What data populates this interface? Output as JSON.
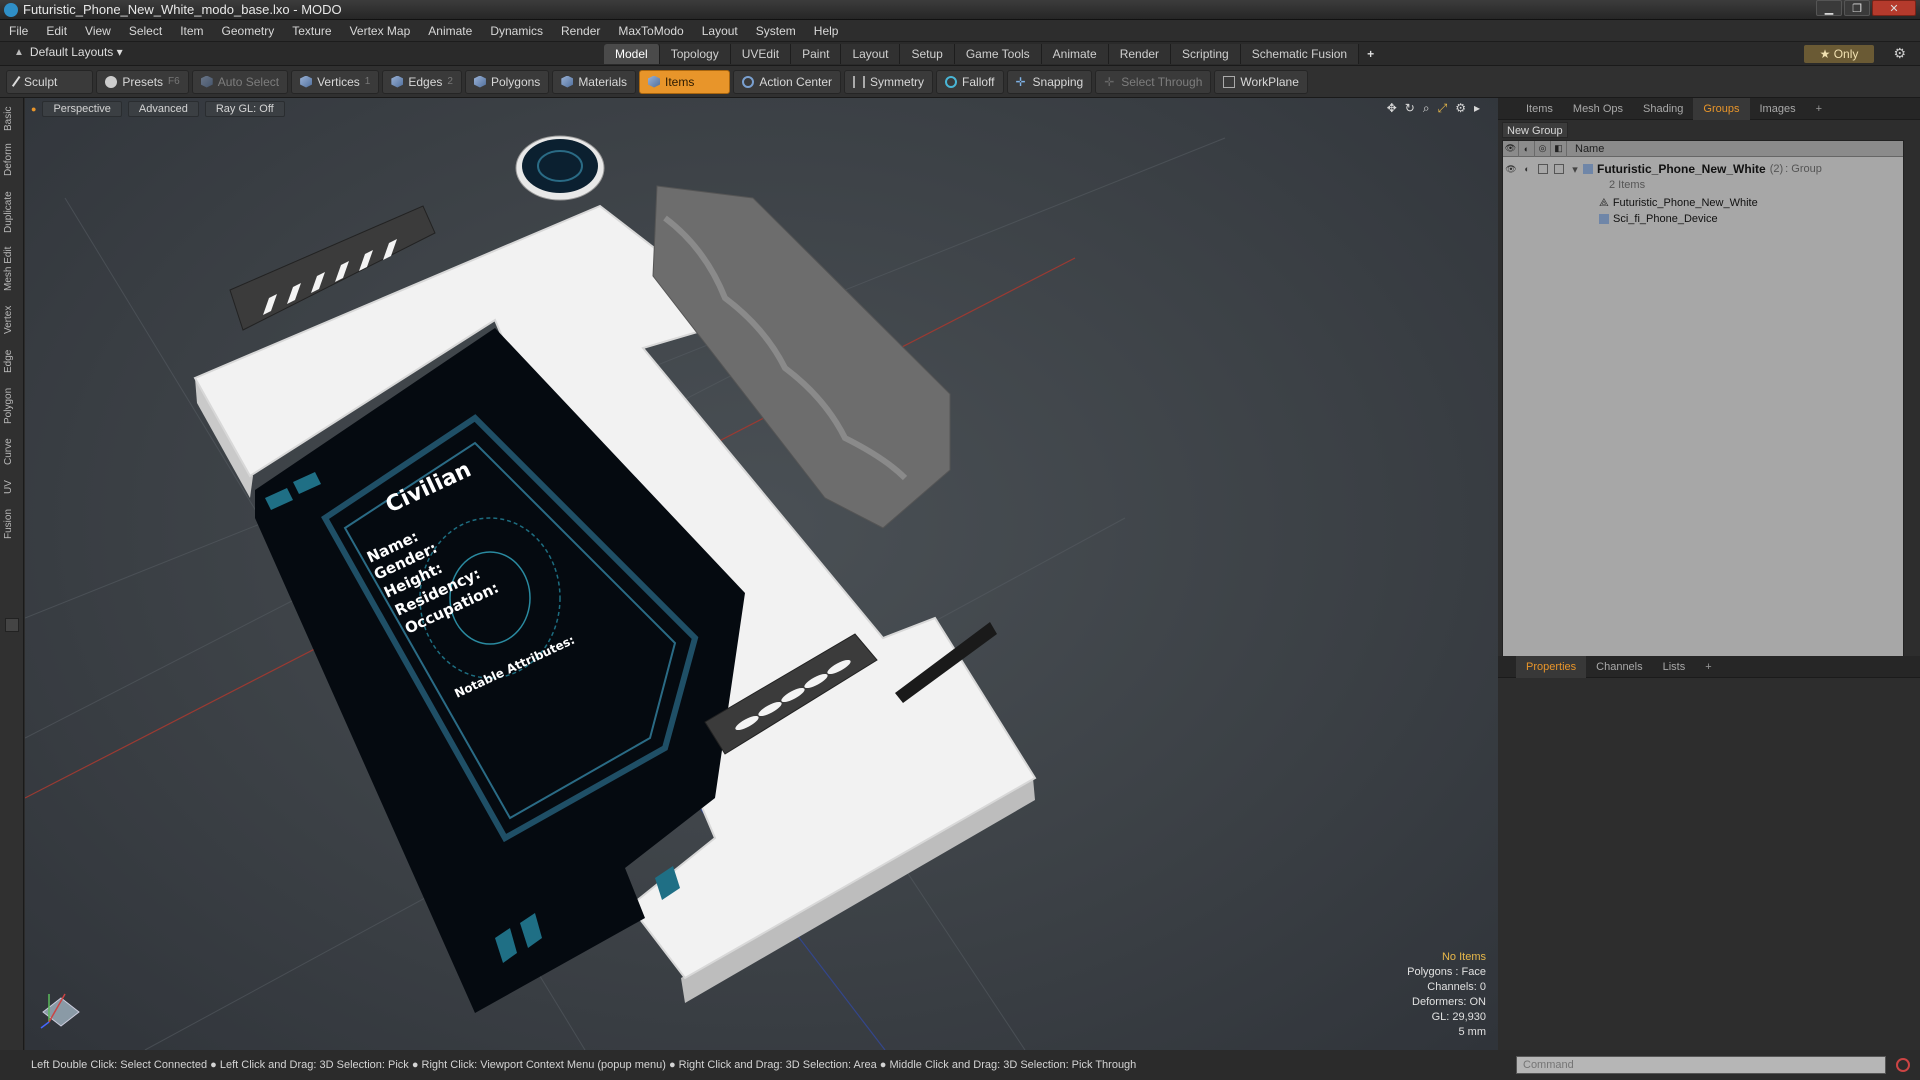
{
  "window": {
    "title": "Futuristic_Phone_New_White_modo_base.lxo - MODO",
    "minimize": "▁",
    "restore": "❐",
    "close": "✕"
  },
  "menu": [
    "File",
    "Edit",
    "View",
    "Select",
    "Item",
    "Geometry",
    "Texture",
    "Vertex Map",
    "Animate",
    "Dynamics",
    "Render",
    "MaxToModo",
    "Layout",
    "System",
    "Help"
  ],
  "layout_selector": "Default Layouts ▾",
  "mode_tabs": [
    "Model",
    "Topology",
    "UVEdit",
    "Paint",
    "Layout",
    "Setup",
    "Game Tools",
    "Animate",
    "Render",
    "Scripting",
    "Schematic Fusion"
  ],
  "mode_tabs_active": "Model",
  "only_button": "★ Only",
  "toolbar": {
    "sculpt": "Sculpt",
    "presets": "Presets",
    "presets_key": "F6",
    "auto_select": "Auto Select",
    "vertices": "Vertices",
    "vertices_key": "1",
    "edges": "Edges",
    "edges_key": "2",
    "polygons": "Polygons",
    "materials": "Materials",
    "items": "Items",
    "action_center": "Action Center",
    "symmetry": "Symmetry",
    "falloff": "Falloff",
    "snapping": "Snapping",
    "select_through": "Select Through",
    "workplane": "WorkPlane"
  },
  "left_tabs": [
    "Basic",
    "Deform",
    "Duplicate",
    "Mesh Edit",
    "Vertex",
    "Edge",
    "Polygon",
    "Curve",
    "UV",
    "Fusion"
  ],
  "viewport": {
    "perspective": "Perspective",
    "advanced": "Advanced",
    "raygl": "Ray GL: Off",
    "screen_texts": [
      "Civilian",
      "Name:",
      "Gender:",
      "Height:",
      "Residency:",
      "Occupation:",
      "Notable Attributes:"
    ],
    "info": {
      "no_items": "No Items",
      "polygons": "Polygons : Face",
      "channels": "Channels: 0",
      "deformers": "Deformers: ON",
      "gl": "GL: 29,930",
      "size": "5 mm"
    }
  },
  "right_tabs": [
    "Items",
    "Mesh Ops",
    "Shading",
    "Groups",
    "Images"
  ],
  "right_tabs_active": "Groups",
  "new_group": "New Group",
  "group_list": {
    "name_header": "Name",
    "group_name": "Futuristic_Phone_New_White",
    "group_count": "(2)",
    "group_type": ": Group",
    "group_items": "2 Items",
    "children": [
      "Futuristic_Phone_New_White",
      "Sci_fi_Phone_Device"
    ]
  },
  "bottom_tabs": [
    "Properties",
    "Channels",
    "Lists"
  ],
  "bottom_tabs_active": "Properties",
  "command_placeholder": "Command",
  "status_text": "Left Double Click: Select Connected ● Left Click and Drag: 3D Selection: Pick ● Right Click: Viewport Context Menu (popup menu) ● Right Click and Drag: 3D Selection: Area ● Middle Click and Drag: 3D Selection: Pick Through"
}
